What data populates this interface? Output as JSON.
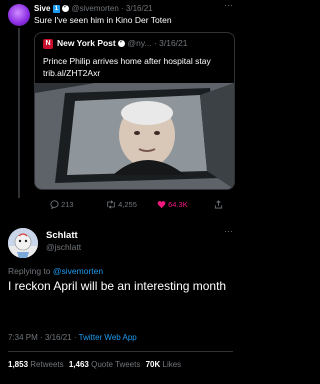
{
  "reply_tweet": {
    "name": "Sive",
    "badge": "1",
    "handle": "@sivemorten",
    "date": "3/16/21",
    "text": "Sure I've seen him in Kino Der Toten",
    "more": "···"
  },
  "quoted": {
    "icon_letter": "N",
    "name": "New York Post",
    "handle": "@ny...",
    "date": "3/16/21",
    "text": "Prince Philip arrives home after hospital stay trib.al/ZHT2Axr"
  },
  "actions": {
    "replies": "213",
    "retweets": "4,255",
    "likes": "64.3K"
  },
  "main_tweet": {
    "name": "Schlatt",
    "handle": "@jschlatt",
    "more": "···",
    "replying_prefix": "Replying to",
    "replying_to": "@sivemorten",
    "text": "I reckon April will be an interesting month",
    "time": "7:34 PM",
    "date": "3/16/21",
    "source": "Twitter Web App",
    "retweets": "1,853",
    "retweets_label": "Retweets",
    "quote_tweets": "1,463",
    "quote_tweets_label": "Quote Tweets",
    "likes": "70K",
    "likes_label": "Likes"
  },
  "colors": {
    "background": "#000000",
    "accent": "#1d9bf0",
    "muted": "#71767b",
    "like": "#f91880",
    "nypost": "#c8102e"
  }
}
